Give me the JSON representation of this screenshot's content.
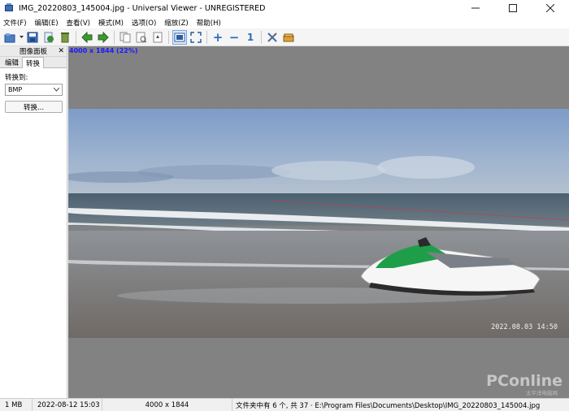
{
  "window": {
    "title": "IMG_20220803_145004.jpg - Universal Viewer - UNREGISTERED",
    "minimize": "—",
    "maximize": "☐",
    "close": "✕"
  },
  "menu": {
    "items": [
      "文件(F)",
      "编辑(E)",
      "查看(V)",
      "模式(M)",
      "选项(O)",
      "缩放(Z)",
      "帮助(H)"
    ]
  },
  "toolbar": {
    "icons": [
      "open-icon",
      "save-icon",
      "reload-icon",
      "recycle-icon",
      "back-arrow-icon",
      "forward-arrow-icon",
      "copy-icon",
      "preview-icon",
      "rotate-icon",
      "fit-window-icon",
      "fullscreen-icon",
      "zoom-in-icon",
      "zoom-out-icon",
      "actual-size-icon",
      "tools-icon",
      "package-icon"
    ],
    "zoom_in_glyph": "+",
    "zoom_out_glyph": "−",
    "actual_size_glyph": "1",
    "accent": "#2d8a2d"
  },
  "panel": {
    "title": "图像面板",
    "close": "✕",
    "tabs": [
      "编辑",
      "转换"
    ],
    "selected_tab": "转换",
    "convert_label": "转换到:",
    "format_value": "BMP",
    "convert_button": "转换..."
  },
  "viewer": {
    "dimensions_overlay": "4000 x 1844 (22%)",
    "photo_stamp": "2022.08.03  14:50",
    "watermark": "PConline",
    "watermark_sub": "太平洋电脑网"
  },
  "statusbar": {
    "size": "1 MB",
    "date": "2022-08-12 15:03",
    "dimensions": "4000 x 1844",
    "path": "文件夹中有 6 个, 共 37 · E:\\Program Files\\Documents\\Desktop\\IMG_20220803_145004.jpg"
  }
}
